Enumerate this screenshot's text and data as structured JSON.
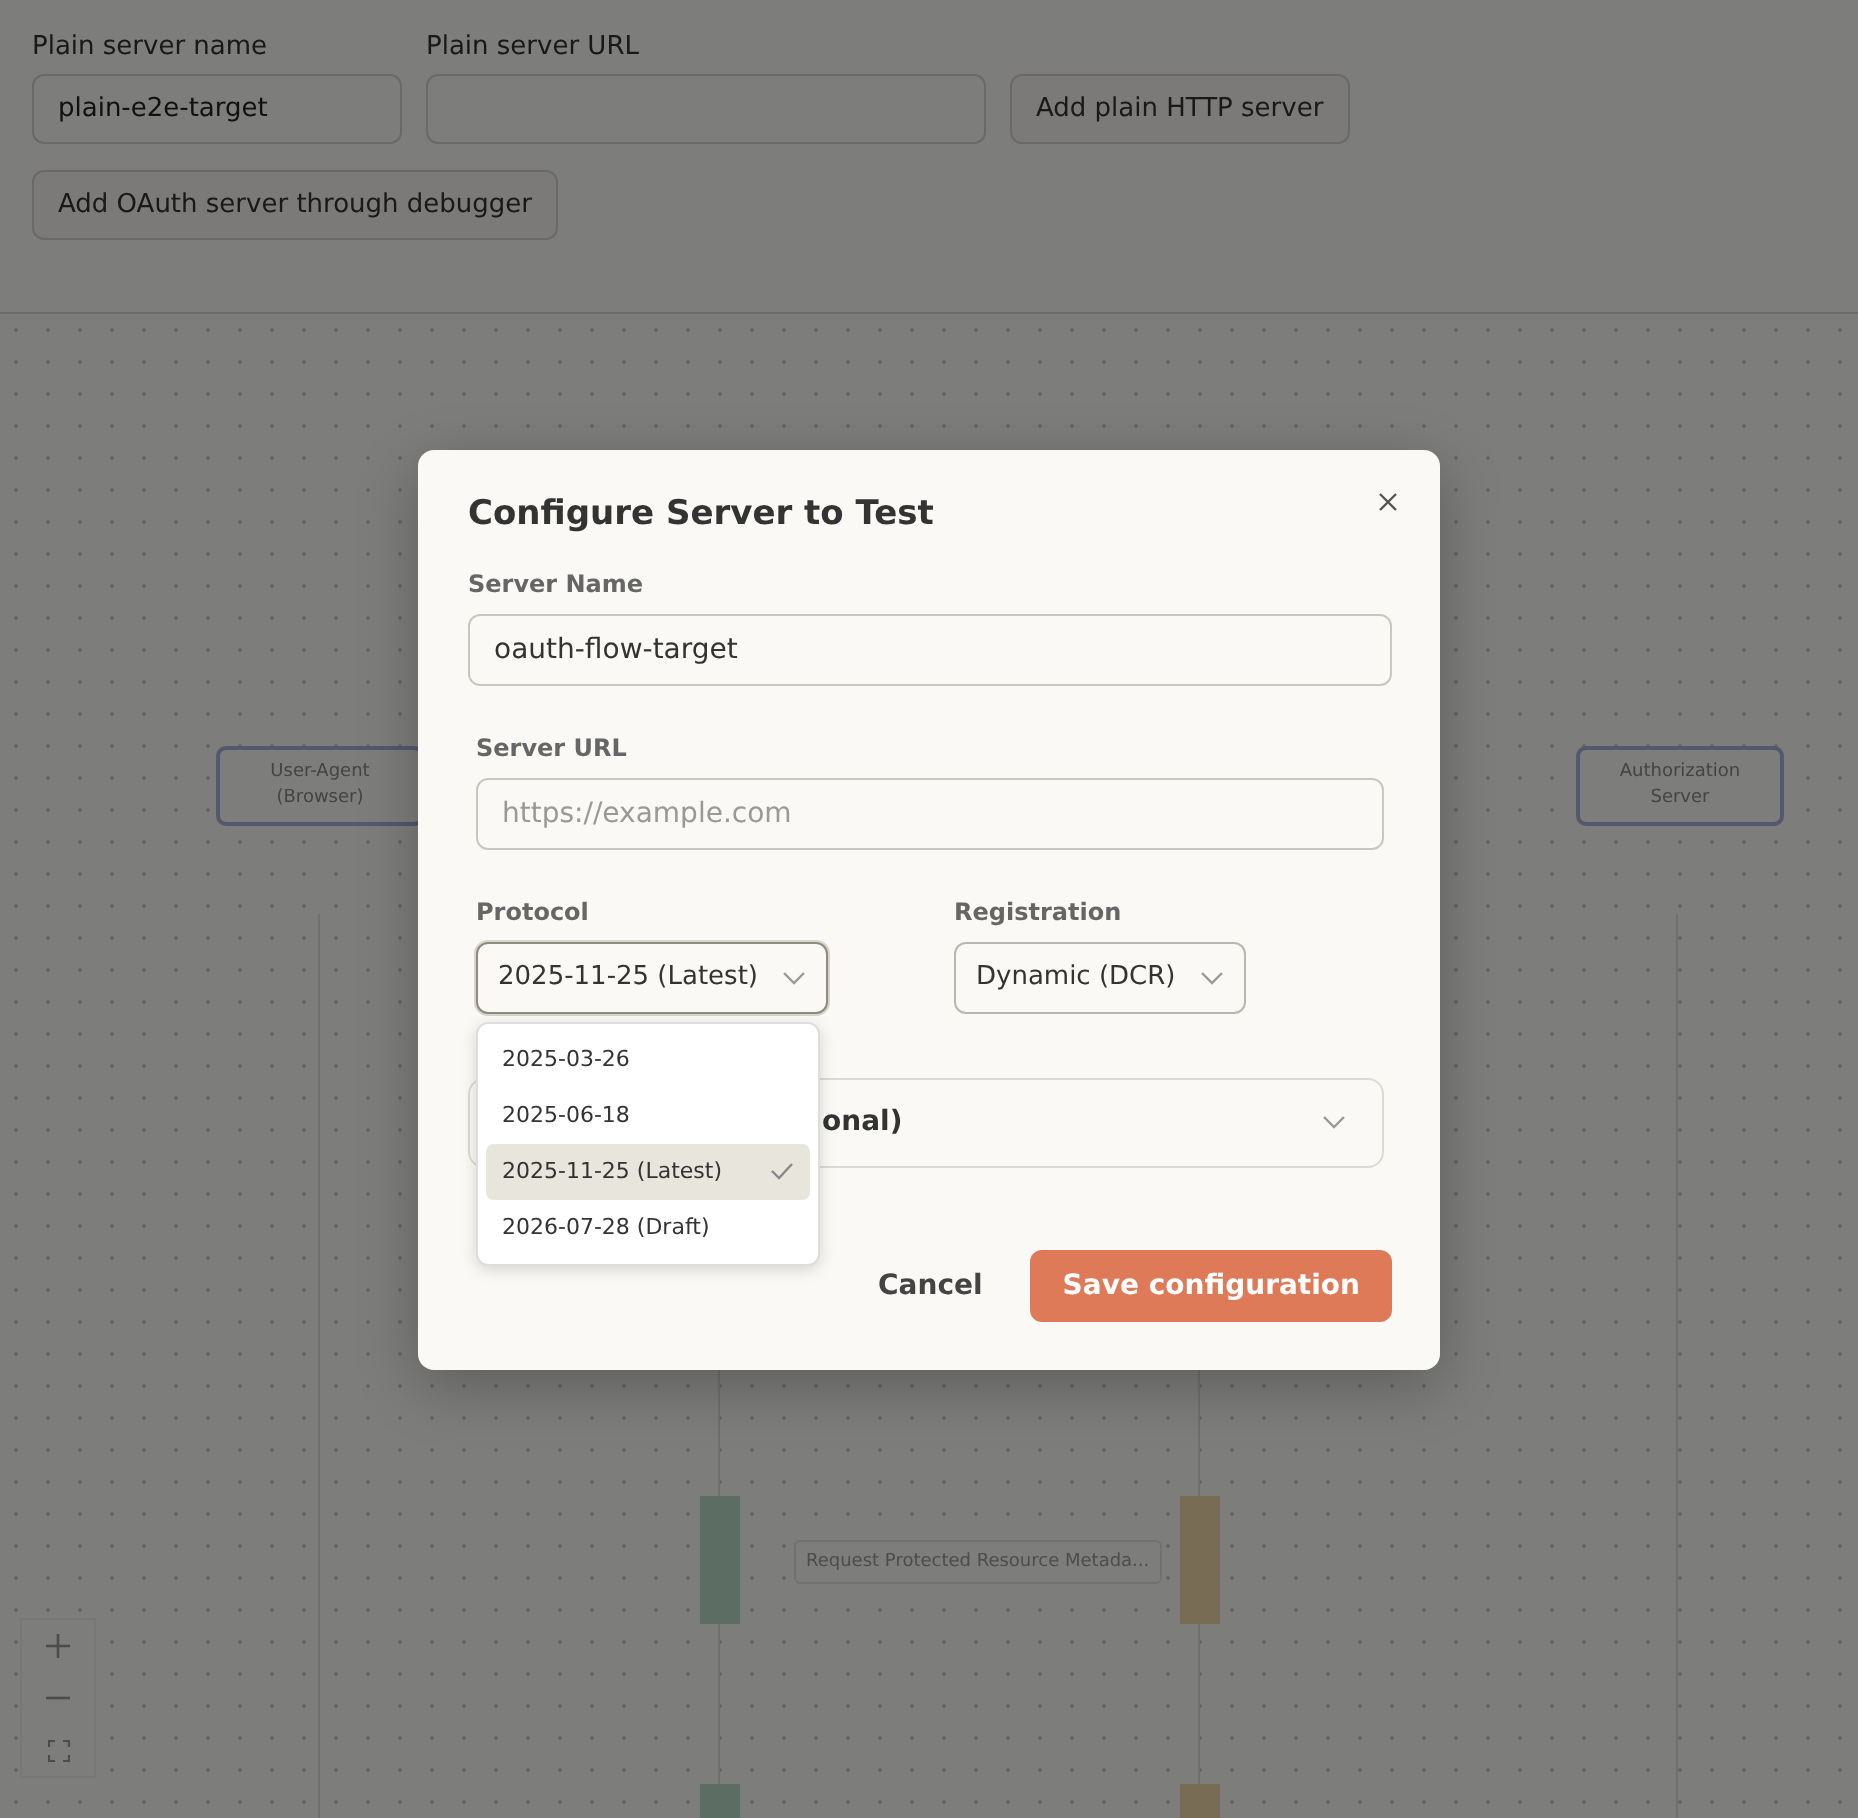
{
  "top_form": {
    "fields": [
      {
        "label": "Plain server name",
        "value": "plain-e2e-target"
      },
      {
        "label": "Plain server URL"
      }
    ],
    "buttons": [
      "Add plain HTTP server",
      "Add OAuth server through debugger"
    ]
  },
  "diagram": {
    "participants": [
      {
        "label_lines": [
          "User-Agent",
          "(Browser)"
        ]
      },
      {
        "label_lines": [
          "Authorization",
          "Server"
        ]
      }
    ],
    "messages": [
      {
        "label": "Request Protected Resource Metada..."
      }
    ]
  },
  "modal": {
    "title": "Configure Server to Test",
    "server_name": {
      "label": "Server Name",
      "value": "oauth-flow-target"
    },
    "server_url": {
      "label": "Server URL",
      "placeholder": "https://example.com"
    },
    "protocol": {
      "label": "Protocol",
      "value": "2025-11-25 (Latest)",
      "expanded": true,
      "options": [
        {
          "label": "2025-03-26",
          "selected": false
        },
        {
          "label": "2025-06-18",
          "selected": false
        },
        {
          "label": "2025-11-25 (Latest)",
          "selected": true
        },
        {
          "label": "2026-07-28 (Draft)",
          "selected": false
        }
      ]
    },
    "registration": {
      "label": "Registration",
      "value": "Dynamic (DCR)"
    },
    "collapsed_section": {
      "label": "onal)",
      "expanded": false
    },
    "buttons": [
      {
        "kind": "secondary",
        "label": "Cancel"
      },
      {
        "kind": "primary",
        "label": "Save configuration"
      }
    ]
  }
}
